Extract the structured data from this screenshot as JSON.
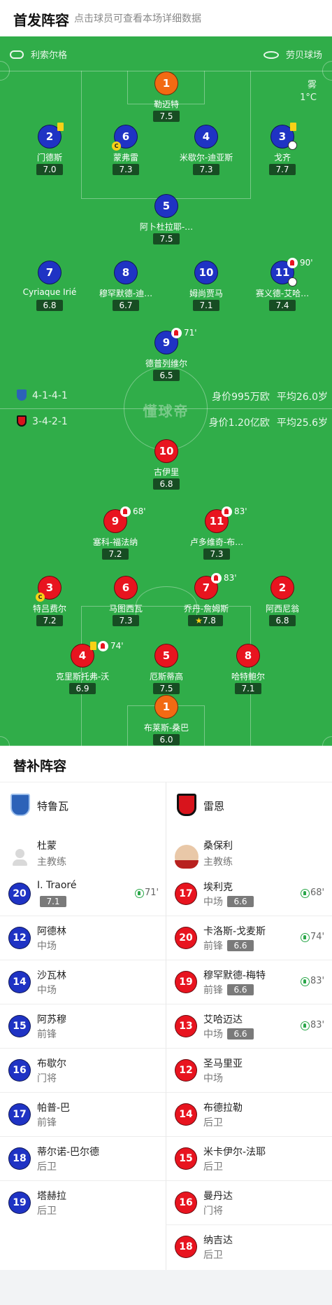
{
  "header": {
    "title": "首发阵容",
    "subtitle": "点击球员可查看本场详细数据"
  },
  "pitch": {
    "referee": "利索尔格",
    "venue": "劳贝球场",
    "weather": "雾",
    "temperature": "1°C",
    "watermark": "懂球帝",
    "home_formation": "4-1-4-1",
    "away_formation": "3-4-2-1",
    "home_value": "身价995万欧",
    "home_age": "平均26.0岁",
    "away_value": "身价1.20亿欧",
    "away_age": "平均25.6岁",
    "colors": {
      "pitch": "#30ad49",
      "home": "#1f33c4",
      "away": "#e8141f",
      "keeper": "#f26a13"
    }
  },
  "home_players": [
    {
      "num": "1",
      "name": "勒迈特",
      "rating": "7.5"
    },
    {
      "num": "2",
      "name": "门德斯",
      "rating": "7.0"
    },
    {
      "num": "6",
      "name": "蒙弗雷",
      "rating": "7.3"
    },
    {
      "num": "4",
      "name": "米歇尔-迪亚斯",
      "rating": "7.3"
    },
    {
      "num": "3",
      "name": "戈齐",
      "rating": "7.7"
    },
    {
      "num": "5",
      "name": "阿卜杜拉耶-…",
      "rating": "7.5"
    },
    {
      "num": "7",
      "name": "Cyriaque Irié",
      "rating": "6.8"
    },
    {
      "num": "8",
      "name": "穆罕默德-迪…",
      "rating": "6.7"
    },
    {
      "num": "10",
      "name": "姆尚贾马",
      "rating": "7.1"
    },
    {
      "num": "11",
      "name": "赛义德-艾哈…",
      "rating": "7.4",
      "sub": "90'"
    },
    {
      "num": "9",
      "name": "德普列维尔",
      "rating": "6.5",
      "sub": "71'"
    }
  ],
  "away_players": [
    {
      "num": "10",
      "name": "古伊里",
      "rating": "6.8"
    },
    {
      "num": "9",
      "name": "塞科-福法纳",
      "rating": "7.2",
      "sub": "68'"
    },
    {
      "num": "11",
      "name": "卢多维奇-布…",
      "rating": "7.3",
      "sub": "83'"
    },
    {
      "num": "3",
      "name": "特吕费尔",
      "rating": "7.2"
    },
    {
      "num": "6",
      "name": "马图西瓦",
      "rating": "7.3"
    },
    {
      "num": "7",
      "name": "乔丹-詹姆斯",
      "rating": "7.8",
      "sub": "83'"
    },
    {
      "num": "2",
      "name": "阿西尼翁",
      "rating": "6.8"
    },
    {
      "num": "4",
      "name": "克里斯托弗-沃",
      "rating": "6.9",
      "sub": "74'"
    },
    {
      "num": "5",
      "name": "厄斯蒂高",
      "rating": "7.5"
    },
    {
      "num": "8",
      "name": "哈特鲍尔",
      "rating": "7.1"
    },
    {
      "num": "1",
      "name": "布莱斯-桑巴",
      "rating": "6.0"
    }
  ],
  "subs": {
    "title": "替补阵容",
    "home_team": "特鲁瓦",
    "away_team": "雷恩",
    "home_coach": {
      "name": "杜蒙",
      "role": "主教练"
    },
    "away_coach": {
      "name": "桑保利",
      "role": "主教练"
    },
    "home": [
      {
        "num": "20",
        "name": "I. Traoré",
        "rating": "7.1",
        "time": "71'"
      },
      {
        "num": "12",
        "name": "阿德林",
        "pos": "中场"
      },
      {
        "num": "14",
        "name": "沙瓦林",
        "pos": "中场"
      },
      {
        "num": "15",
        "name": "阿苏穆",
        "pos": "前锋"
      },
      {
        "num": "16",
        "name": "布歇尔",
        "pos": "门将"
      },
      {
        "num": "17",
        "name": "帕普-巴",
        "pos": "前锋"
      },
      {
        "num": "18",
        "name": "蒂尔诺-巴尔德",
        "pos": "后卫"
      },
      {
        "num": "19",
        "name": "塔赫拉",
        "pos": "后卫"
      }
    ],
    "away": [
      {
        "num": "17",
        "name": "埃利克",
        "pos": "中场",
        "rating": "6.6",
        "time": "68'"
      },
      {
        "num": "20",
        "name": "卡洛斯-戈麦斯",
        "pos": "前锋",
        "rating": "6.6",
        "time": "74'"
      },
      {
        "num": "19",
        "name": "穆罕默德-梅特",
        "pos": "前锋",
        "rating": "6.6",
        "time": "83'"
      },
      {
        "num": "13",
        "name": "艾哈迈达",
        "pos": "中场",
        "rating": "6.6",
        "time": "83'"
      },
      {
        "num": "12",
        "name": "圣马里亚",
        "pos": "中场"
      },
      {
        "num": "14",
        "name": "布德拉勒",
        "pos": "后卫"
      },
      {
        "num": "15",
        "name": "米卡伊尔-法耶",
        "pos": "后卫"
      },
      {
        "num": "16",
        "name": "曼丹达",
        "pos": "门将"
      },
      {
        "num": "18",
        "name": "纳吉达",
        "pos": "后卫"
      }
    ]
  }
}
